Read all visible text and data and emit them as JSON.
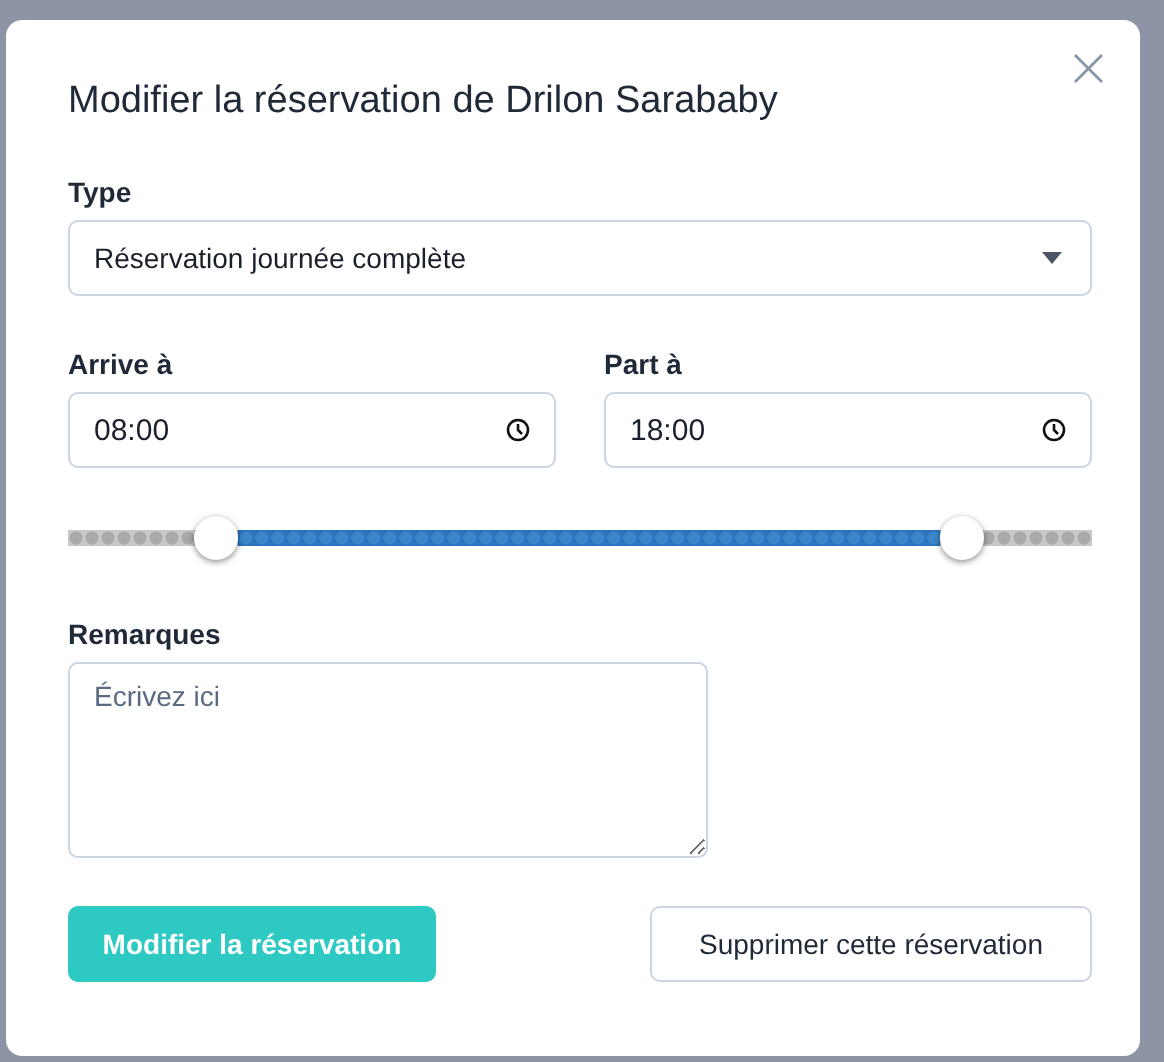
{
  "dialog": {
    "title": "Modifier la réservation de Drilon Sarababy",
    "close": "×"
  },
  "type_field": {
    "label": "Type",
    "value": "Réservation journée complète"
  },
  "time_fields": [
    {
      "label": "Arrive à",
      "value": "08:00"
    },
    {
      "label": "Part à",
      "value": "18:00"
    }
  ],
  "time_slider": {
    "thumbs": [
      {
        "level": 0.145
      },
      {
        "level": 0.873
      }
    ]
  },
  "remarks": {
    "label": "Remarques",
    "placeholder": "Écrivez ici"
  },
  "buttons": [
    {
      "label": "Modifier la réservation",
      "kind": "primary"
    },
    {
      "label": "Supprimer cette réservation",
      "kind": "secondary"
    }
  ]
}
